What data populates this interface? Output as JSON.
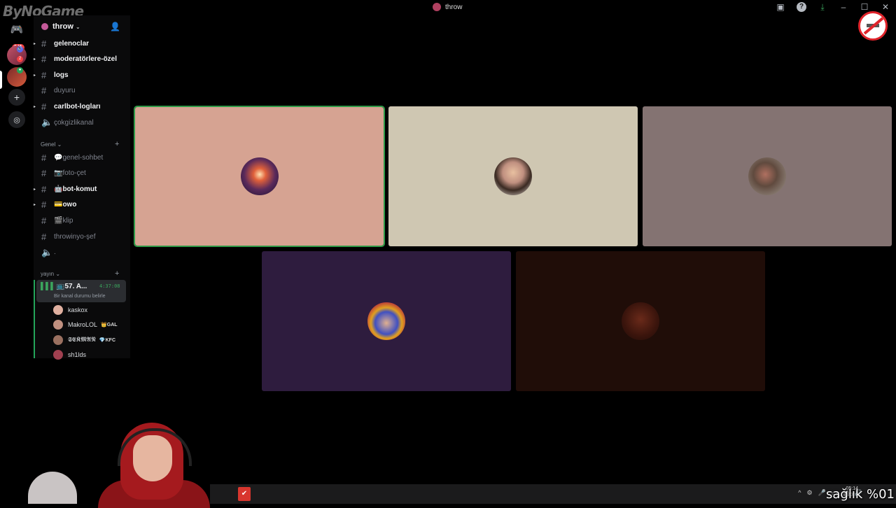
{
  "watermark": "ByNoGame",
  "window": {
    "title": "throw"
  },
  "rail": {
    "home_badge": "241",
    "server1_badge": "2"
  },
  "server": {
    "name": "throw"
  },
  "channels": [
    {
      "name": "gelenoclar",
      "state": "unread",
      "arrow": true,
      "icon": "#"
    },
    {
      "name": "moderatörlere-özel",
      "state": "unread",
      "arrow": true,
      "icon": "#"
    },
    {
      "name": "logs",
      "state": "unread",
      "arrow": true,
      "icon": "#"
    },
    {
      "name": "duyuru",
      "state": "read",
      "arrow": false,
      "icon": "#"
    },
    {
      "name": "carlbot-logları",
      "state": "unread",
      "arrow": true,
      "icon": "#"
    },
    {
      "name": "çokgizlikanal",
      "state": "read",
      "arrow": false,
      "icon": "speaker"
    }
  ],
  "categories": {
    "genel": "Genel",
    "yayin": "yayın"
  },
  "genel_channels": [
    {
      "name": "💬genel-sohbet",
      "state": "read",
      "arrow": false,
      "icon": "#"
    },
    {
      "name": "📷foto-çet",
      "state": "read",
      "arrow": false,
      "icon": "#"
    },
    {
      "name": "🤖bot-komut",
      "state": "unread",
      "arrow": true,
      "icon": "#"
    },
    {
      "name": "💳owo",
      "state": "unread",
      "arrow": true,
      "icon": "#"
    },
    {
      "name": "🎬klip",
      "state": "read",
      "arrow": false,
      "icon": "#"
    },
    {
      "name": "throwinyo-şef",
      "state": "read",
      "arrow": false,
      "icon": "#"
    },
    {
      "name": ".",
      "state": "read",
      "arrow": false,
      "icon": "speaker"
    }
  ],
  "voice": {
    "channel_name": "📺57. A...",
    "timer": "4:37:08",
    "status": "Bir kanal durumu belirle"
  },
  "voice_users": [
    {
      "name": "kaskox",
      "tag": "",
      "color": "#e0b0a0"
    },
    {
      "name": "MakroLOL",
      "tag": "👑GAL",
      "color": "#c09080"
    },
    {
      "name": "𝕾𝕰𝕶𝕸𝕬𝕹",
      "tag": "💎KFC",
      "color": "#9a7060"
    },
    {
      "name": "sh1lds",
      "tag": "",
      "color": "#a04050"
    }
  ],
  "overlay": {
    "health_text": "sağlık %01"
  },
  "taskbar": {
    "time": "05:14",
    "date": "2.10.2026"
  },
  "colors": {
    "speaking_outline": "#2e9a47",
    "unread": "#f2f3f5",
    "read": "#80848e",
    "voice_green": "#3ba55d"
  }
}
